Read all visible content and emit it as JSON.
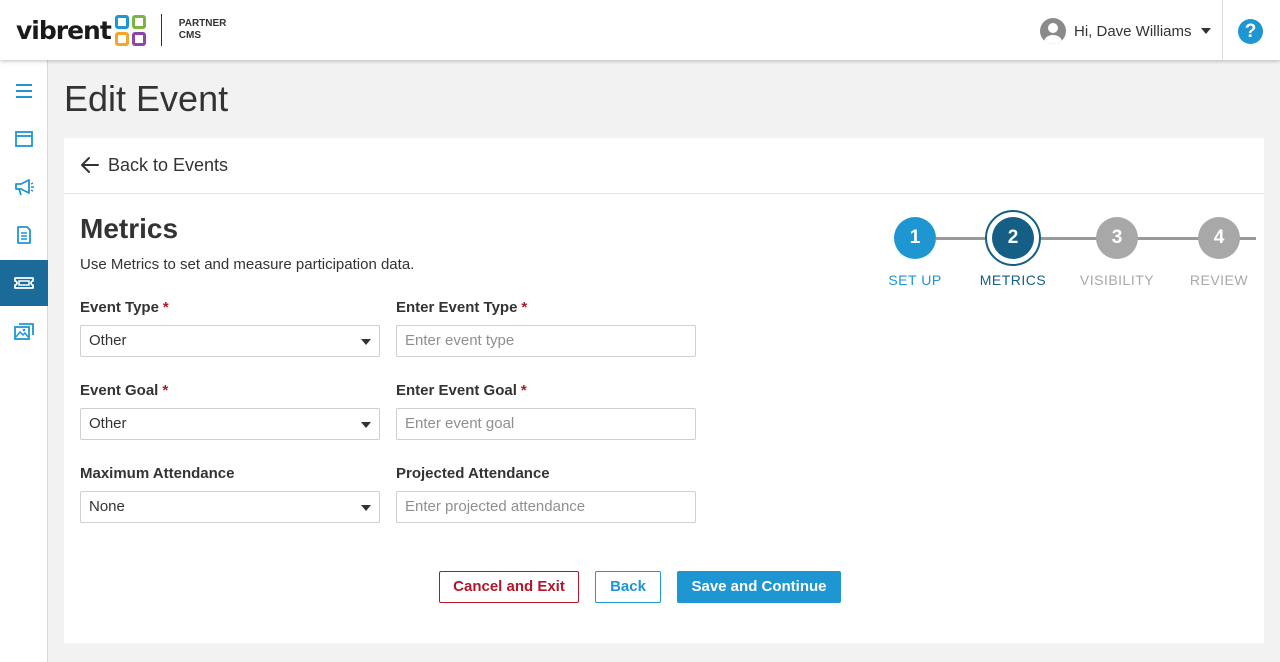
{
  "header": {
    "logo_text": "vibrent",
    "logo_sub_line1": "PARTNER",
    "logo_sub_line2": "CMS",
    "logo_colors": [
      "#1e96d2",
      "#7cb342",
      "#f4a52a",
      "#8e44ad"
    ],
    "user_greeting": "Hi, Dave Williams",
    "help_symbol": "?"
  },
  "sidebar": {
    "items": [
      {
        "icon": "menu-icon",
        "active": false
      },
      {
        "icon": "browser-window-icon",
        "active": false
      },
      {
        "icon": "megaphone-icon",
        "active": false
      },
      {
        "icon": "document-icon",
        "active": false
      },
      {
        "icon": "ticket-icon",
        "active": true
      },
      {
        "icon": "media-gallery-icon",
        "active": false
      }
    ]
  },
  "page": {
    "title": "Edit Event",
    "back_link": "Back to Events"
  },
  "section": {
    "title": "Metrics",
    "description": "Use Metrics to set and measure participation data."
  },
  "form": {
    "event_type": {
      "label": "Event Type",
      "value": "Other",
      "required": "*"
    },
    "enter_event_type": {
      "label": "Enter Event Type",
      "placeholder": "Enter event type",
      "required": "*"
    },
    "event_goal": {
      "label": "Event Goal",
      "value": "Other",
      "required": "*"
    },
    "enter_event_goal": {
      "label": "Enter Event Goal",
      "placeholder": "Enter event goal",
      "required": "*"
    },
    "max_attendance": {
      "label": "Maximum Attendance",
      "value": "None"
    },
    "projected_attendance": {
      "label": "Projected Attendance",
      "placeholder": "Enter projected attendance"
    }
  },
  "stepper": {
    "steps": [
      {
        "number": "1",
        "label": "SET UP",
        "state": "complete"
      },
      {
        "number": "2",
        "label": "METRICS",
        "state": "current"
      },
      {
        "number": "3",
        "label": "VISIBILITY",
        "state": "upcoming"
      },
      {
        "number": "4",
        "label": "REVIEW",
        "state": "upcoming"
      }
    ],
    "colors": {
      "complete": "#1e96d2",
      "current": "#155f86",
      "upcoming": "#a8a8a8"
    }
  },
  "actions": {
    "cancel_label": "Cancel and Exit",
    "back_label": "Back",
    "save_label": "Save and Continue"
  }
}
